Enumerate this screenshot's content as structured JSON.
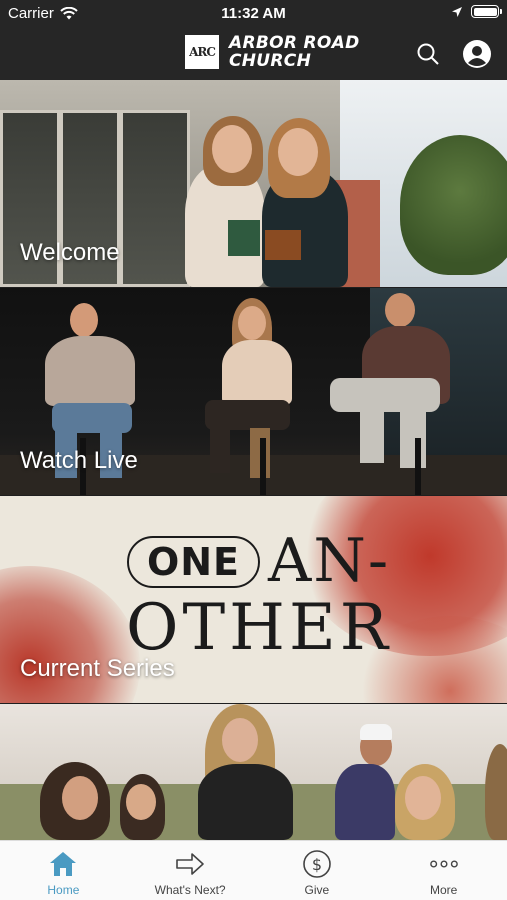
{
  "status_bar": {
    "carrier": "Carrier",
    "time": "11:32 AM"
  },
  "header": {
    "logo_text": "ARC",
    "brand_line1": "ARBOR ROAD",
    "brand_line2": "CHURCH"
  },
  "panels": [
    {
      "label": "Welcome"
    },
    {
      "label": "Watch Live"
    },
    {
      "label": "Current Series"
    },
    {
      "label": ""
    }
  ],
  "series_art": {
    "pill_text": "ONE",
    "word_top": "AN-",
    "word_bottom": "OTHER"
  },
  "tabs": [
    {
      "label": "Home",
      "icon": "home-icon",
      "active": true
    },
    {
      "label": "What's Next?",
      "icon": "arrow-right-icon",
      "active": false
    },
    {
      "label": "Give",
      "icon": "dollar-circle-icon",
      "active": false
    },
    {
      "label": "More",
      "icon": "more-dots-icon",
      "active": false
    }
  ],
  "colors": {
    "header_bg": "#262626",
    "tab_active": "#4a9ac2",
    "tab_inactive": "#444444",
    "series_accent": "#c0392b"
  }
}
